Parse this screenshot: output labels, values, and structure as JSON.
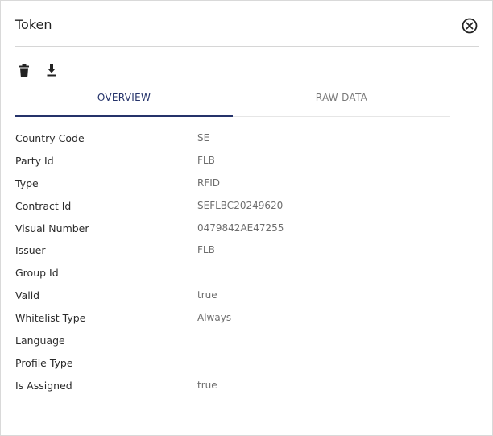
{
  "dialog": {
    "title": "Token"
  },
  "toolbar": {
    "delete_icon": "trash-icon",
    "download_icon": "download-icon"
  },
  "tabs": [
    {
      "label": "OVERVIEW",
      "active": true
    },
    {
      "label": "RAW DATA",
      "active": false
    }
  ],
  "properties": [
    {
      "key": "Country Code",
      "value": "SE"
    },
    {
      "key": "Party Id",
      "value": "FLB"
    },
    {
      "key": "Type",
      "value": "RFID"
    },
    {
      "key": "Contract Id",
      "value": "SEFLBC20249620"
    },
    {
      "key": "Visual Number",
      "value": "0479842AE47255"
    },
    {
      "key": "Issuer",
      "value": "FLB"
    },
    {
      "key": "Group Id",
      "value": ""
    },
    {
      "key": "Valid",
      "value": "true"
    },
    {
      "key": "Whitelist Type",
      "value": "Always"
    },
    {
      "key": "Language",
      "value": ""
    },
    {
      "key": "Profile Type",
      "value": ""
    },
    {
      "key": "Is Assigned",
      "value": "true"
    }
  ],
  "colors": {
    "accent": "#25336a",
    "muted": "#7a7a7a"
  }
}
